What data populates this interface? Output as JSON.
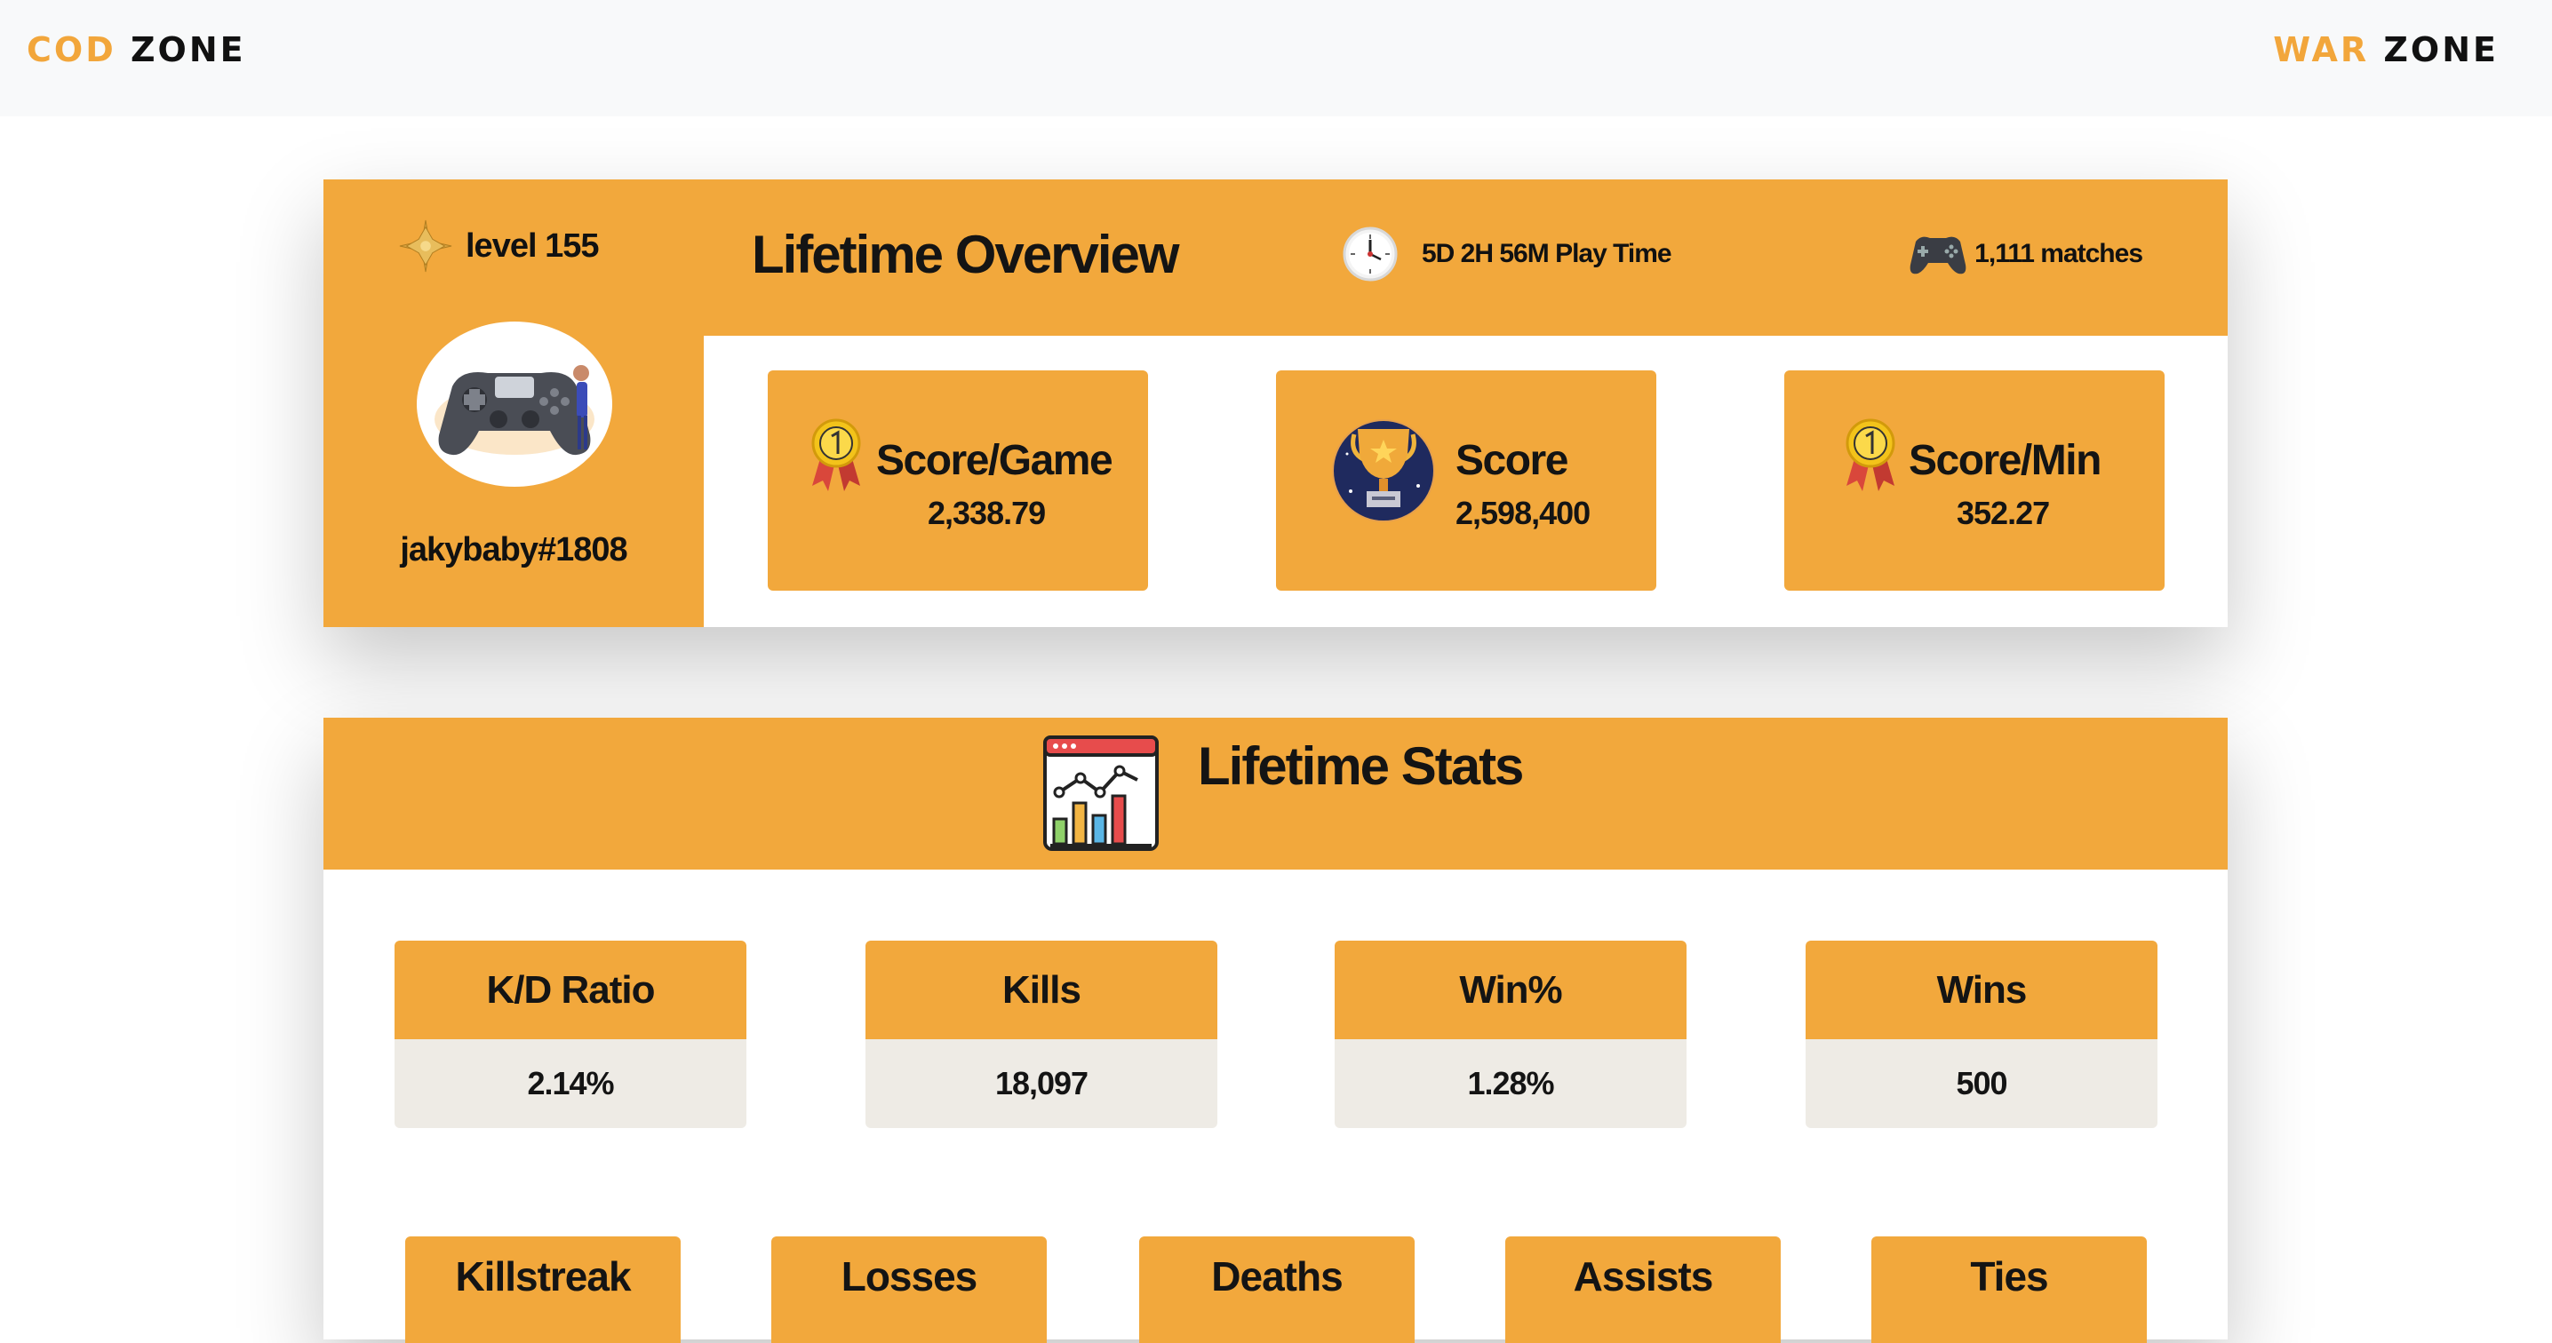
{
  "brand_left": {
    "accent": "COD",
    "dark": "ZONE"
  },
  "brand_right": {
    "accent": "WAR",
    "dark": "ZONE"
  },
  "profile": {
    "level_label": "level 155",
    "level_icon": "gold-star-icon",
    "avatar_icon": "gamer-avatar-icon",
    "username": "jakybaby#1808"
  },
  "overview": {
    "title": "Lifetime Overview",
    "playtime": "5D 2H 56M Play Time",
    "playtime_icon": "clock-icon",
    "matches": "1,111 matches",
    "matches_icon": "gamepad-icon",
    "tiles": [
      {
        "label": "Score/Game",
        "value": "2,338.79",
        "icon": "medal-icon"
      },
      {
        "label": "Score",
        "value": "2,598,400",
        "icon": "trophy-icon"
      },
      {
        "label": "Score/Min",
        "value": "352.27",
        "icon": "medal-icon"
      }
    ]
  },
  "stats": {
    "title": "Lifetime Stats",
    "icon": "chart-dashboard-icon",
    "row1": [
      {
        "label": "K/D Ratio",
        "value": "2.14%"
      },
      {
        "label": "Kills",
        "value": "18,097"
      },
      {
        "label": "Win%",
        "value": "1.28%"
      },
      {
        "label": "Wins",
        "value": "500"
      }
    ],
    "row2": [
      {
        "label": "Killstreak"
      },
      {
        "label": "Losses"
      },
      {
        "label": "Deaths"
      },
      {
        "label": "Assists"
      },
      {
        "label": "Ties"
      }
    ]
  },
  "colors": {
    "accent": "#f2a83c",
    "value_bg": "#eeebe5",
    "topbar_bg": "#f8f9fa"
  }
}
